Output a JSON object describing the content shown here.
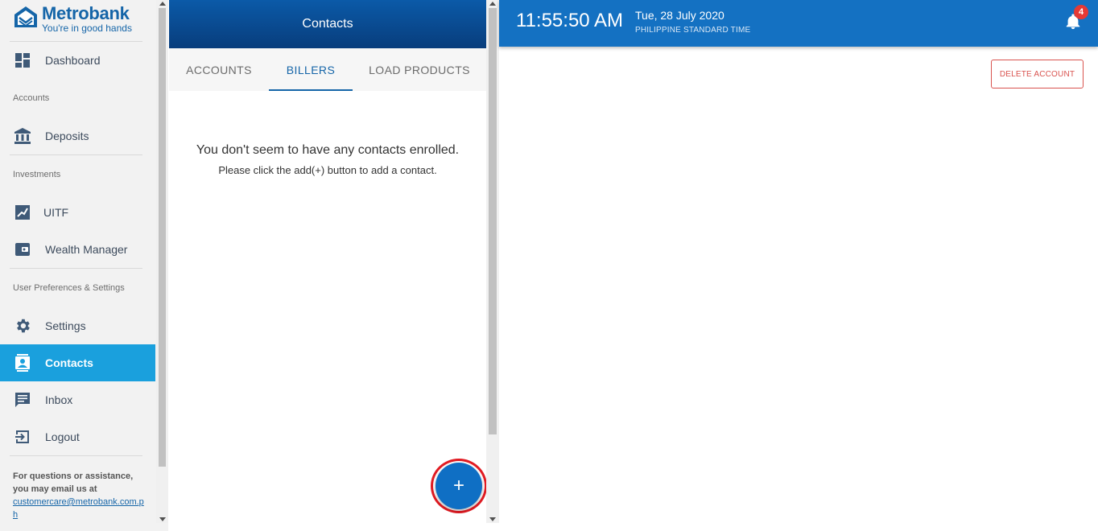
{
  "brand": {
    "name": "Metrobank",
    "tagline": "You're in good hands"
  },
  "sidebar": {
    "items": {
      "dashboard": "Dashboard",
      "deposits": "Deposits",
      "uitf": "UITF",
      "wealth_manager": "Wealth Manager",
      "settings": "Settings",
      "contacts": "Contacts",
      "inbox": "Inbox",
      "logout": "Logout"
    },
    "sections": {
      "accounts": "Accounts",
      "investments": "Investments",
      "preferences": "User Preferences & Settings"
    },
    "support": {
      "line1": "For questions or assistance,",
      "line2": "you may email us at",
      "email": "customercare@metrobank.com.ph"
    },
    "active_item": "contacts"
  },
  "contacts_panel": {
    "title": "Contacts",
    "tabs": [
      "ACCOUNTS",
      "BILLERS",
      "LOAD PRODUCTS"
    ],
    "active_tab": "BILLERS",
    "empty_title": "You don't seem to have any contacts enrolled.",
    "empty_subtitle": "Please click the add(+) button to add a contact.",
    "fab_label": "+"
  },
  "topbar": {
    "time": "11:55:50 AM",
    "date": "Tue, 28 July 2020",
    "timezone": "PHILIPPINE STANDARD TIME",
    "notification_count": "4"
  },
  "main": {
    "delete_account_label": "DELETE ACCOUNT"
  },
  "colors": {
    "brand_blue": "#1565a8",
    "topbar_blue": "#1471c2",
    "active_nav": "#1aa0dd",
    "fab_blue": "#0f6fc4",
    "highlight_red": "#e11b22",
    "danger": "#d9534f"
  }
}
